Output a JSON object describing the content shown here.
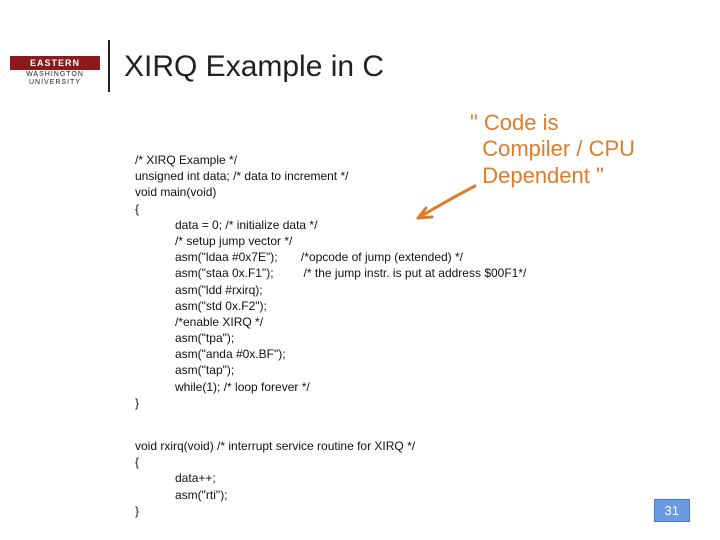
{
  "logo": {
    "top": "EASTERN",
    "bottom1": "WASHINGTON",
    "bottom2": "UNIVERSITY"
  },
  "title": "XIRQ Example in C",
  "code_main": "/* XIRQ Example */\nunsigned int data; /* data to increment */\nvoid main(void)\n{\n            data = 0; /* initialize data */\n            /* setup jump vector */\n            asm(\"ldaa #0x7E\");       /*opcode of jump (extended) */\n            asm(\"staa 0x.F1\");         /* the jump instr. is put at address $00F1*/\n            asm(\"ldd #rxirq);\n            asm(\"std 0x.F2\");\n            /*enable XIRQ */\n            asm(\"tpa\");\n            asm(\"anda #0x.BF\");\n            asm(\"tap\");\n            while(1); /* loop forever */\n}",
  "code_isr": "void rxirq(void) /* interrupt service routine for XIRQ */\n{\n            data++;\n            asm(\"rti\");\n}",
  "annotation": "\" Code is\n  Compiler / CPU\n  Dependent \"",
  "page_number": "31"
}
